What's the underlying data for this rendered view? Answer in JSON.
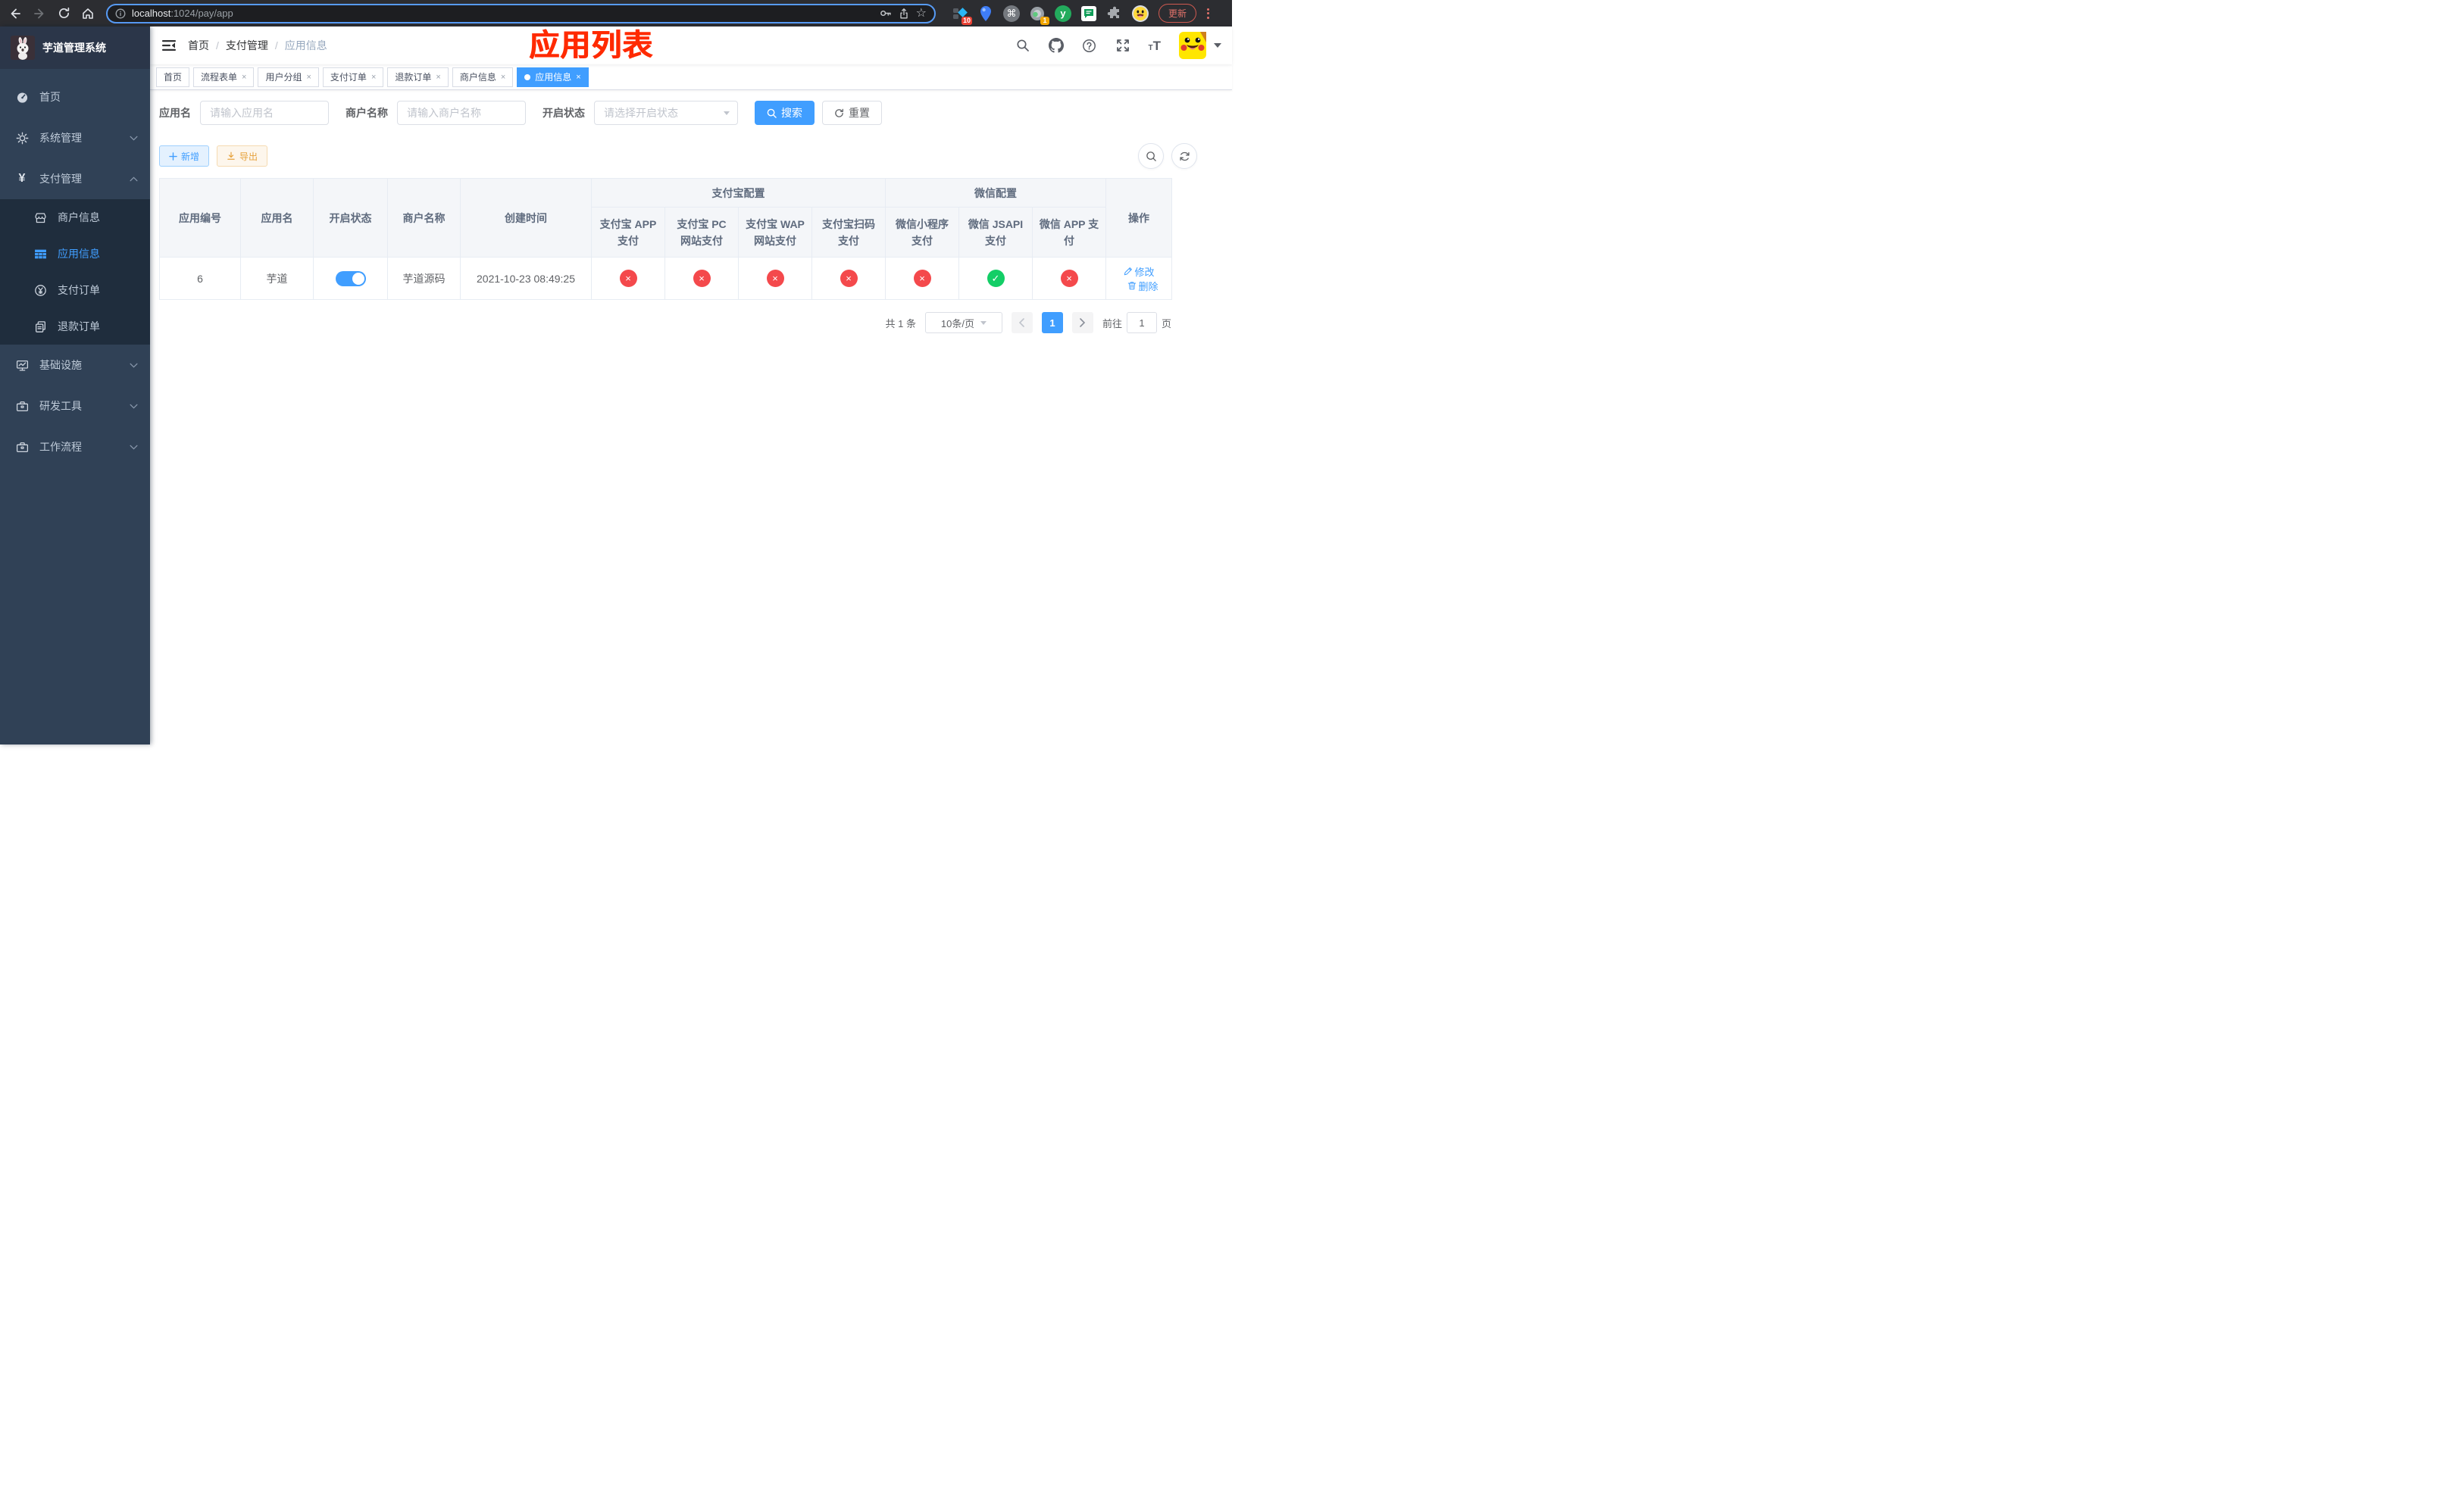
{
  "browser": {
    "url_host": "localhost",
    "url_path": ":1024/pay/app",
    "update_button": "更新",
    "ext_badge_blue_diamond": "10",
    "ext_badge_record": "1"
  },
  "sidebar": {
    "title": "芋道管理系统",
    "menu_home": "首页",
    "menu_system": "系统管理",
    "menu_pay": "支付管理",
    "submenu": [
      "商户信息",
      "应用信息",
      "支付订单",
      "退款订单"
    ],
    "menu_infra": "基础设施",
    "menu_devtools": "研发工具",
    "menu_workflow": "工作流程"
  },
  "navbar": {
    "breadcrumb": [
      "首页",
      "支付管理",
      "应用信息"
    ],
    "annotation": "应用列表"
  },
  "tabs": [
    {
      "label": "首页"
    },
    {
      "label": "流程表单"
    },
    {
      "label": "用户分组"
    },
    {
      "label": "支付订单"
    },
    {
      "label": "退款订单"
    },
    {
      "label": "商户信息"
    },
    {
      "label": "应用信息"
    }
  ],
  "filters": {
    "app_name_label": "应用名",
    "app_name_placeholder": "请输入应用名",
    "merchant_label": "商户名称",
    "merchant_placeholder": "请输入商户名称",
    "status_label": "开启状态",
    "status_placeholder": "请选择开启状态",
    "search_button": "搜索",
    "reset_button": "重置"
  },
  "toolbar": {
    "add_button": "新增",
    "export_button": "导出"
  },
  "table": {
    "headers": [
      "应用编号",
      "应用名",
      "开启状态",
      "商户名称",
      "创建时间"
    ],
    "groups": [
      {
        "label": "支付宝配置",
        "children": [
          "支付宝 APP 支付",
          "支付宝 PC 网站支付",
          "支付宝 WAP 网站支付",
          "支付宝扫码支付"
        ]
      },
      {
        "label": "微信配置",
        "children": [
          "微信小程序支付",
          "微信 JSAPI 支付",
          "微信 APP 支付"
        ]
      }
    ],
    "action_header": "操作",
    "row": {
      "id": "6",
      "name": "芋道",
      "enabled": true,
      "merchant": "芋道源码",
      "created_at": "2021-10-23 08:49:25",
      "pay_status": [
        "fail",
        "fail",
        "fail",
        "fail",
        "fail",
        "pass",
        "fail"
      ],
      "action_edit": "修改",
      "action_delete": "删除"
    }
  },
  "pagination": {
    "total": "共 1 条",
    "page_size": "10条/页",
    "page": "1",
    "goto_label": "前往",
    "goto_value": "1",
    "goto_suffix": "页"
  },
  "glyphs": {
    "pass": "✓",
    "fail": "×",
    "close": "×",
    "breadcrumb_sep": "/",
    "star": "☆",
    "cmd": "⌘",
    "yen": "¥",
    "ext_y": "y"
  },
  "colors": {
    "primary": "#409eff",
    "success": "#13ce66",
    "danger": "#f4494c",
    "annotation": "#ff2a00",
    "sidebar_bg": "#304156",
    "submenu_bg": "#1f2d3d"
  }
}
